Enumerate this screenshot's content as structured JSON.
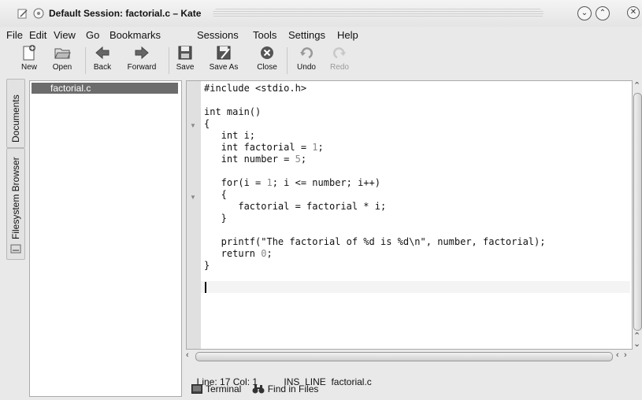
{
  "window": {
    "title": "Default Session: factorial.c – Kate"
  },
  "menu": [
    "File",
    "Edit",
    "View",
    "Go",
    "Bookmarks",
    "Sessions",
    "Tools",
    "Settings",
    "Help"
  ],
  "toolbar": {
    "new": "New",
    "open": "Open",
    "back": "Back",
    "forward": "Forward",
    "save": "Save",
    "save_as": "Save As",
    "close": "Close",
    "undo": "Undo",
    "redo": "Redo"
  },
  "side_tabs": {
    "documents": "Documents",
    "filesystem": "Filesystem Browser"
  },
  "documents": [
    "factorial.c"
  ],
  "code": [
    "#include <stdio.h>",
    "",
    "int main()",
    "{",
    "   int i;",
    "   int factorial = 1;",
    "   int number = 5;",
    "",
    "   for(i = 1; i <= number; i++)",
    "   {",
    "      factorial = factorial * i;",
    "   }",
    "",
    "   printf(\"The factorial of %d is %d\\n\", number, factorial);",
    "   return 0;",
    "}",
    ""
  ],
  "status": {
    "position": "Line: 17 Col: 1",
    "mode": "INS",
    "line_mode": "LINE",
    "filename": "factorial.c"
  },
  "bottom_tabs": {
    "terminal": "Terminal",
    "find": "Find in Files"
  }
}
